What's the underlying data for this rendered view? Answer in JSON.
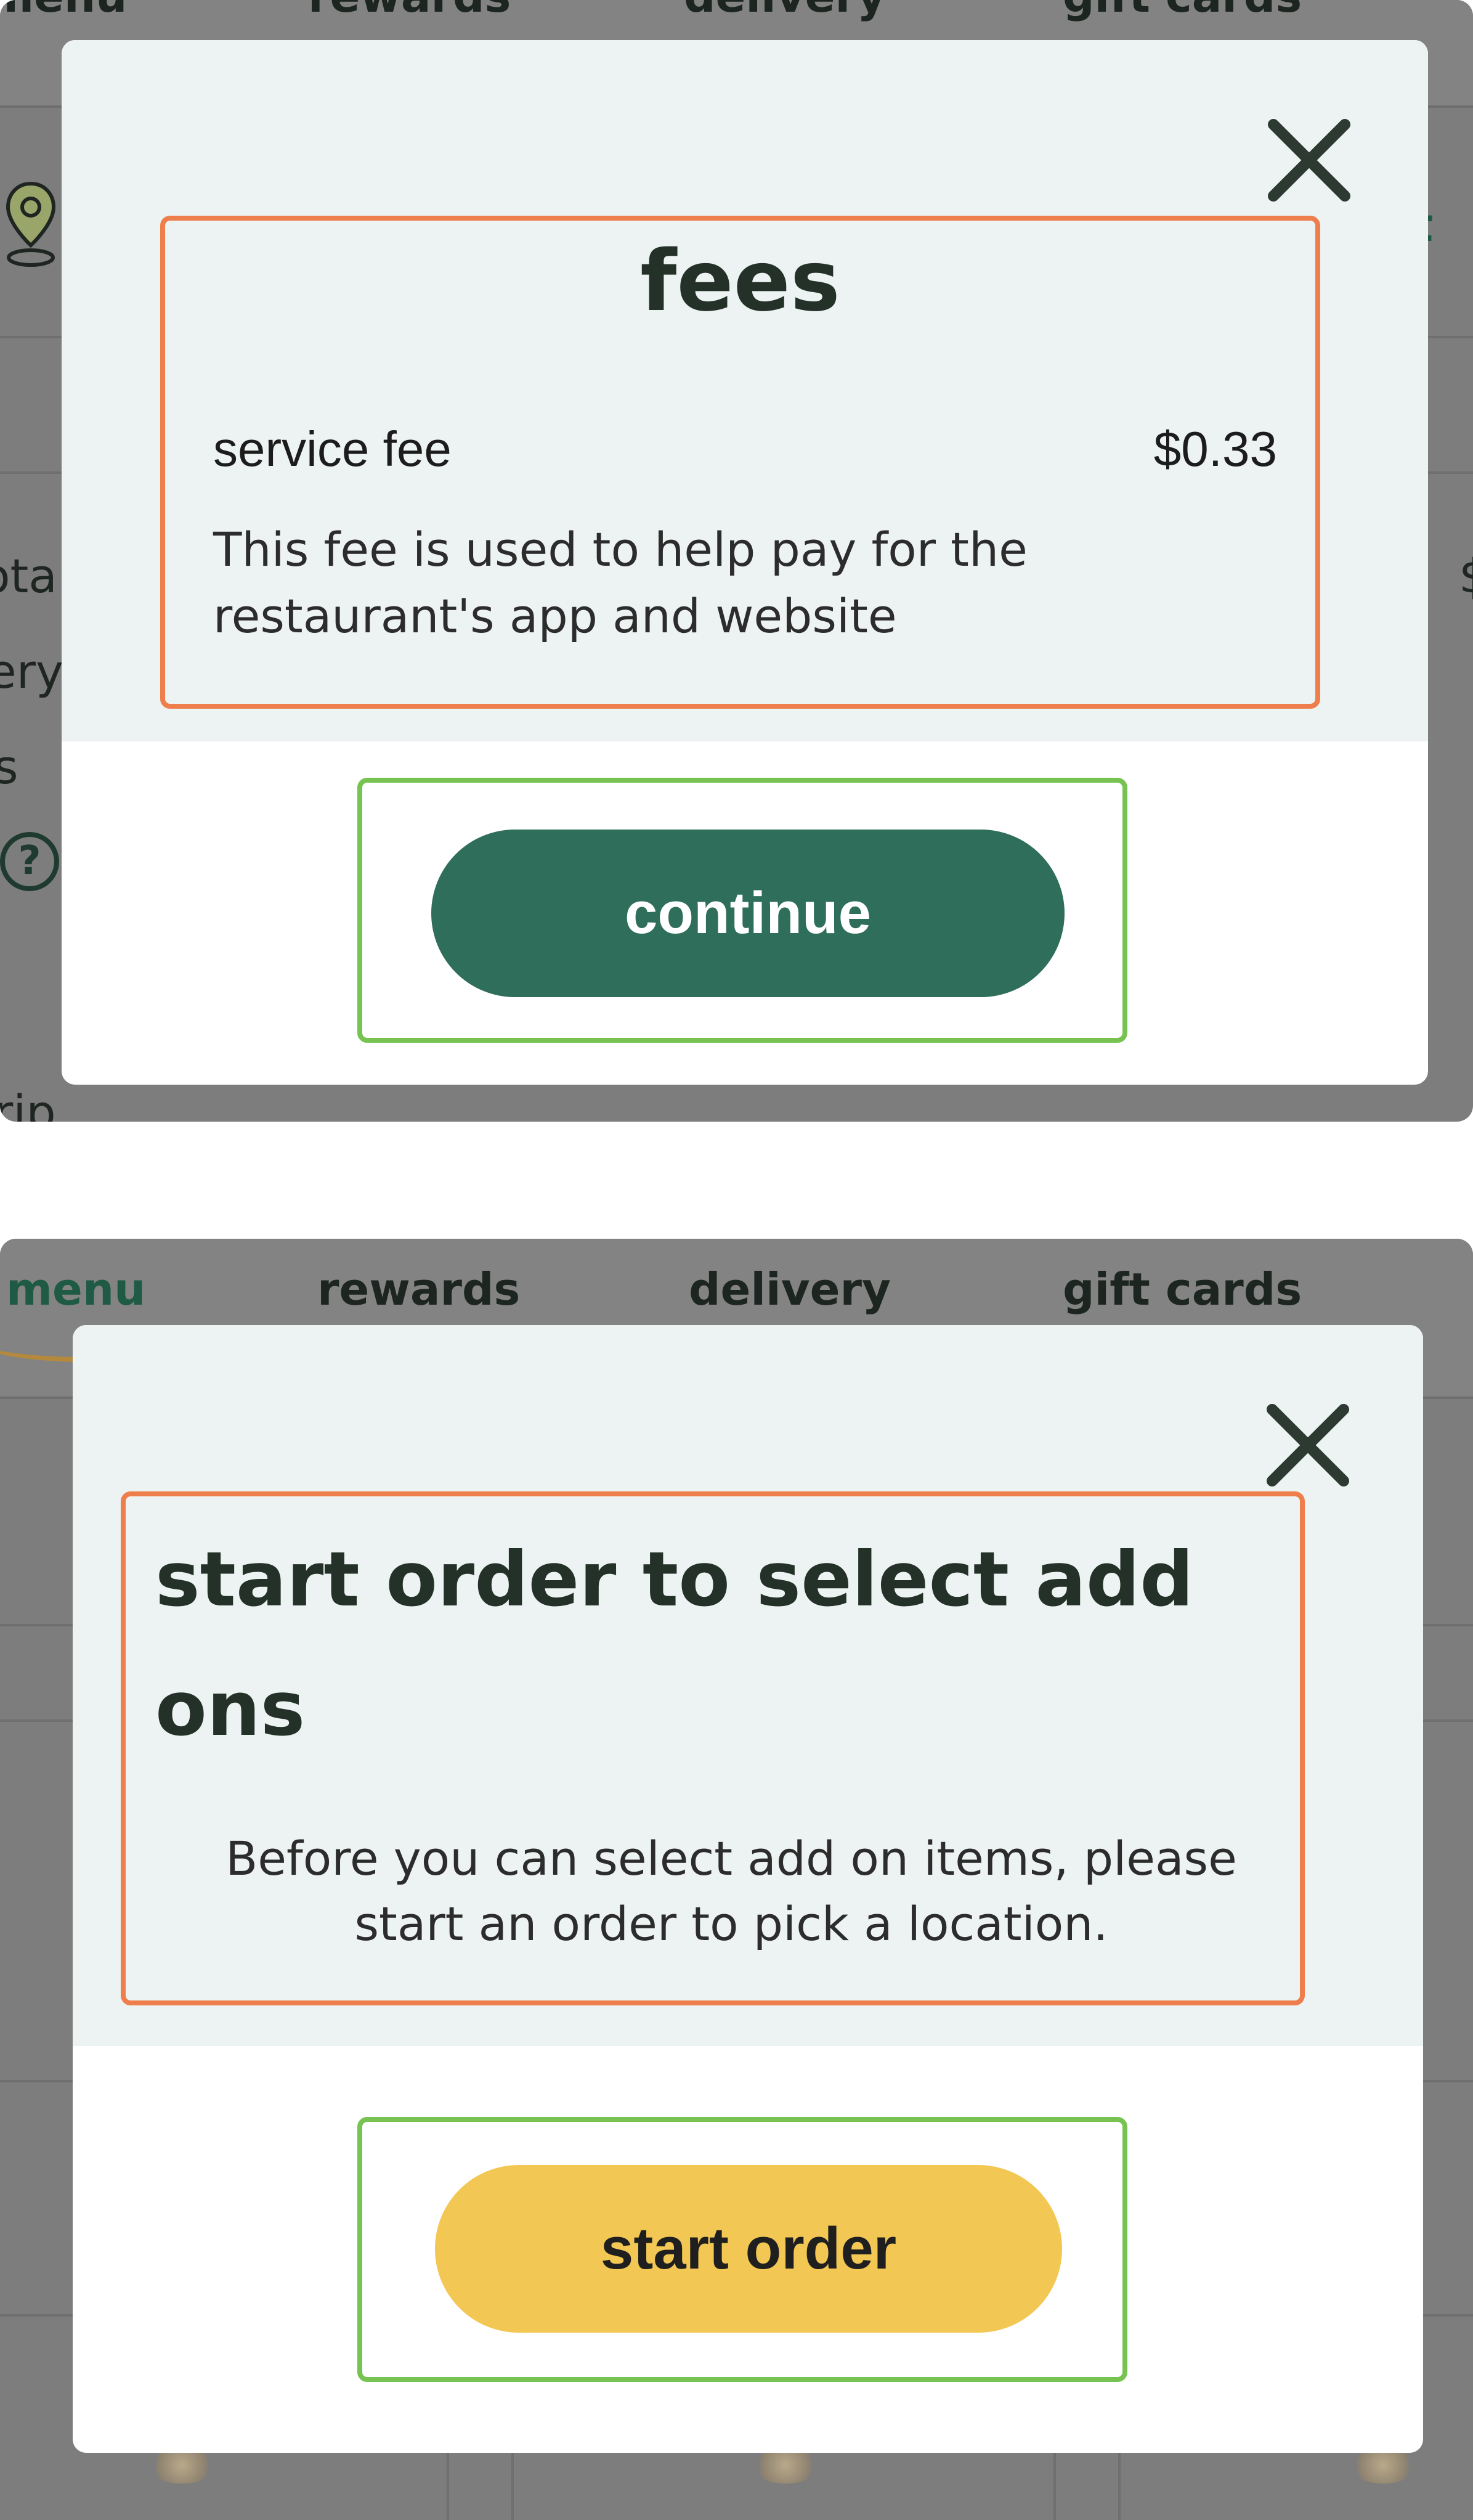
{
  "nav": {
    "menu": "menu",
    "rewards": "rewards",
    "delivery": "delivery",
    "gift_cards": "gift cards"
  },
  "background_fragments": {
    "top_right_link": "t",
    "row1": "ota",
    "row2": "ery",
    "row3": "s",
    "row_right": "$",
    "row_bottom": "rip",
    "help_glyph": "?"
  },
  "fees_modal": {
    "title": "fees",
    "fee_label": "service fee",
    "fee_amount": "$0.33",
    "description": "This fee is used to help pay for the restaurant's app and website",
    "continue_label": "continue",
    "button_color": "#2e6e5a"
  },
  "addons_modal": {
    "title": "start order to select add ons",
    "message": "Before you can select add on items, please start an order to pick a location.",
    "start_order_label": "start order",
    "button_color": "#f2c753"
  },
  "colors": {
    "highlight_orange": "#ef7e4d",
    "highlight_green": "#76c352",
    "modal_header_bg": "#edf3f2",
    "overlay": "#7d7d7d",
    "text_dark": "#243128"
  }
}
